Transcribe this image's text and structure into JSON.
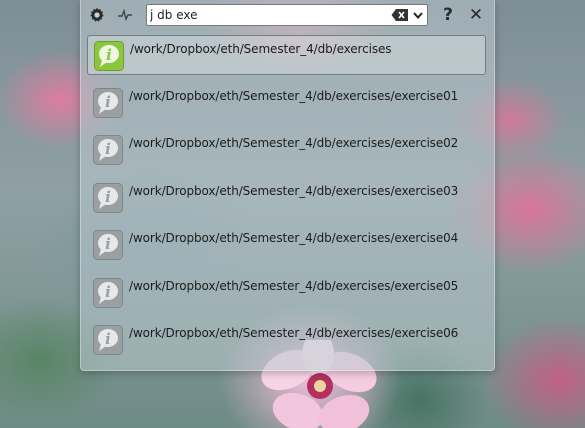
{
  "toolbar": {
    "icons": [
      "gear-icon",
      "activity-icon"
    ],
    "help_label": "?",
    "close_label": "✕"
  },
  "search": {
    "value": "j db exe",
    "placeholder": "",
    "icons": [
      "backspace-clear-icon",
      "chevron-down-icon"
    ]
  },
  "results": [
    {
      "path": "/work/Dropbox/eth/Semester_4/db/exercises",
      "selected": true,
      "icon": "info-bubble-icon"
    },
    {
      "path": "/work/Dropbox/eth/Semester_4/db/exercises/exercise01",
      "selected": false,
      "icon": "info-bubble-icon"
    },
    {
      "path": "/work/Dropbox/eth/Semester_4/db/exercises/exercise02",
      "selected": false,
      "icon": "info-bubble-icon"
    },
    {
      "path": "/work/Dropbox/eth/Semester_4/db/exercises/exercise03",
      "selected": false,
      "icon": "info-bubble-icon"
    },
    {
      "path": "/work/Dropbox/eth/Semester_4/db/exercises/exercise04",
      "selected": false,
      "icon": "info-bubble-icon"
    },
    {
      "path": "/work/Dropbox/eth/Semester_4/db/exercises/exercise05",
      "selected": false,
      "icon": "info-bubble-icon"
    },
    {
      "path": "/work/Dropbox/eth/Semester_4/db/exercises/exercise06",
      "selected": false,
      "icon": "info-bubble-icon"
    }
  ],
  "colors": {
    "selected_icon": "#8cc63f",
    "unselected_icon": "#9a9fa2",
    "panel": "#b9c8cd"
  }
}
